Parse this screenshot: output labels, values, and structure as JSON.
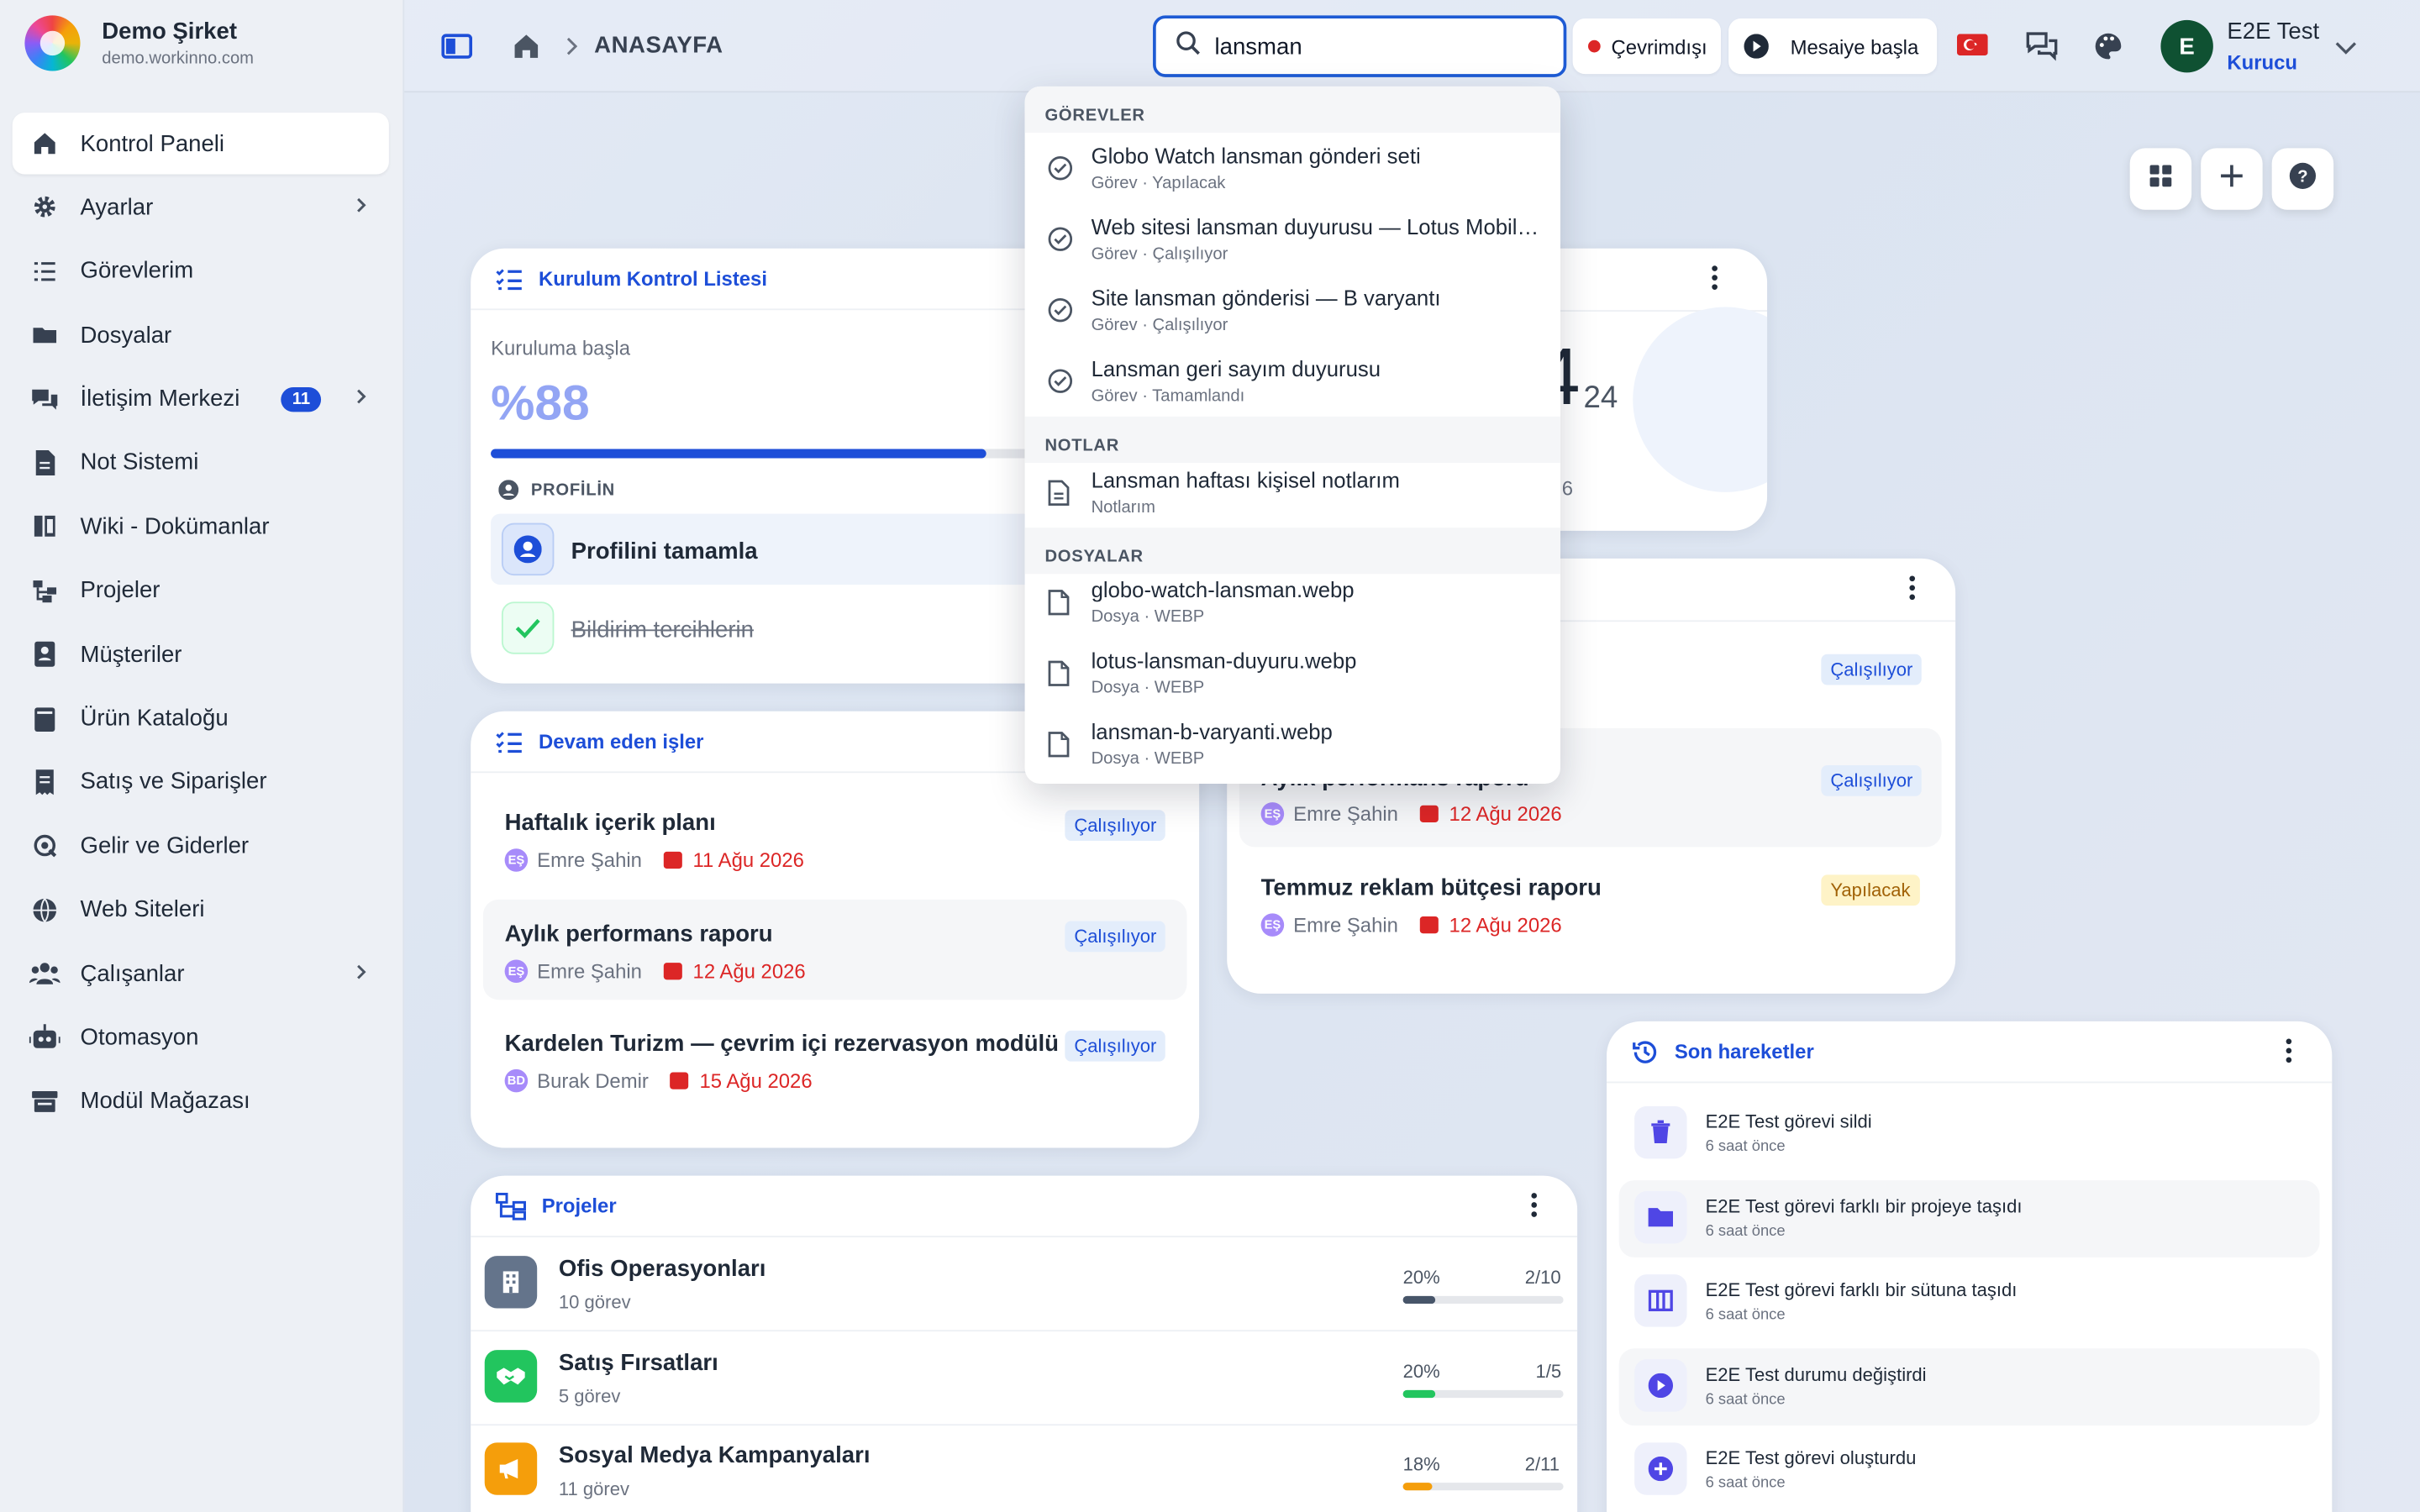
{
  "brand": {
    "name": "Demo Şirket",
    "domain": "demo.workinno.com"
  },
  "sidebar": {
    "items": [
      {
        "label": "Kontrol Paneli",
        "icon": "home-icon"
      },
      {
        "label": "Ayarlar",
        "icon": "gear-icon"
      },
      {
        "label": "Görevlerim",
        "icon": "tasks-icon"
      },
      {
        "label": "Dosyalar",
        "icon": "folder-icon"
      },
      {
        "label": "İletişim Merkezi",
        "icon": "chat-icon",
        "badge": "11"
      },
      {
        "label": "Not Sistemi",
        "icon": "note-icon"
      },
      {
        "label": "Wiki - Dokümanlar",
        "icon": "book-icon"
      },
      {
        "label": "Projeler",
        "icon": "project-icon"
      },
      {
        "label": "Müşteriler",
        "icon": "contact-icon"
      },
      {
        "label": "Ürün Kataloğu",
        "icon": "catalog-icon"
      },
      {
        "label": "Satış ve Siparişler",
        "icon": "receipt-icon"
      },
      {
        "label": "Gelir ve Giderler",
        "icon": "money-icon"
      },
      {
        "label": "Web Siteleri",
        "icon": "globe-icon"
      },
      {
        "label": "Çalışanlar",
        "icon": "people-icon"
      },
      {
        "label": "Otomasyon",
        "icon": "robot-icon"
      },
      {
        "label": "Modül Mağazası",
        "icon": "store-icon"
      }
    ]
  },
  "header": {
    "breadcrumb": "ANASAYFA",
    "search_value": "lansman",
    "status": "Çevrimdışı",
    "shift": "Mesaiye başla",
    "user_name": "E2E Test",
    "user_role": "Kurucu",
    "avatar": "E"
  },
  "search_results": {
    "sections": {
      "tasks": "GÖREVLER",
      "notes": "NOTLAR",
      "files": "DOSYALAR"
    },
    "tasks": [
      {
        "title": "Globo Watch lansman gönderi seti",
        "sub": "Görev · Yapılacak"
      },
      {
        "title": "Web sitesi lansman duyurusu — Lotus Mobilya",
        "sub": "Görev · Çalışılıyor"
      },
      {
        "title": "Site lansman gönderisi — B varyantı",
        "sub": "Görev · Çalışılıyor"
      },
      {
        "title": "Lansman geri sayım duyurusu",
        "sub": "Görev · Tamamlandı"
      }
    ],
    "notes": [
      {
        "title": "Lansman haftası kişisel notlarım",
        "sub": "Notlarım"
      }
    ],
    "files": [
      {
        "title": "globo-watch-lansman.webp",
        "sub": "Dosya · WEBP"
      },
      {
        "title": "lotus-lansman-duyuru.webp",
        "sub": "Dosya · WEBP"
      },
      {
        "title": "lansman-b-varyanti.webp",
        "sub": "Dosya · WEBP"
      }
    ]
  },
  "setup": {
    "title": "Kurulum Kontrol Listesi",
    "start_label": "Kuruluma başla",
    "percent_text": "%88",
    "progress": 0.88,
    "section": "PROFİLİN",
    "items": [
      {
        "label": "Profilini tamamla"
      },
      {
        "label": "Bildirim tercihlerin"
      }
    ]
  },
  "stats_card": {
    "big": "4",
    "small": "24",
    "sub": "6"
  },
  "ongoing": {
    "title": "Devam eden işler",
    "rows": [
      {
        "title": "Haftalık içerik planı",
        "user": "Emre Şahin",
        "initials": "EŞ",
        "due": "11 Ağu 2026",
        "status": "Çalışılıyor"
      },
      {
        "title": "Aylık performans raporu",
        "user": "Emre Şahin",
        "initials": "EŞ",
        "due": "12 Ağu 2026",
        "status": "Çalışılıyor"
      },
      {
        "title": "Kardelen Turizm — çevrim içi rezervasyon modülü",
        "user": "Burak Demir",
        "initials": "BD",
        "due": "15 Ağu 2026",
        "status": "Çalışılıyor"
      }
    ]
  },
  "right_tasks": {
    "rows": [
      {
        "status": "Çalışılıyor"
      },
      {
        "title": "Aylık performans raporu",
        "user": "Emre Şahin",
        "initials": "EŞ",
        "due": "12 Ağu 2026",
        "status": "Çalışılıyor"
      },
      {
        "title": "Temmuz reklam bütçesi raporu",
        "user": "Emre Şahin",
        "initials": "EŞ",
        "due": "12 Ağu 2026",
        "status": "Yapılacak"
      }
    ]
  },
  "activity": {
    "title": "Son hareketler",
    "items": [
      {
        "text": "E2E Test görevi sildi",
        "time": "6 saat önce",
        "icon": "trash-icon"
      },
      {
        "text": "E2E Test görevi farklı bir projeye taşıdı",
        "time": "6 saat önce",
        "icon": "folder-open-icon"
      },
      {
        "text": "E2E Test görevi farklı bir sütuna taşıdı",
        "time": "6 saat önce",
        "icon": "columns-icon"
      },
      {
        "text": "E2E Test durumu değiştirdi",
        "time": "6 saat önce",
        "icon": "play-icon"
      },
      {
        "text": "E2E Test görevi oluşturdu",
        "time": "6 saat önce",
        "icon": "plus-circle-icon"
      }
    ]
  },
  "projects": {
    "title": "Projeler",
    "items": [
      {
        "name": "Ofis Operasyonları",
        "sub": "10 görev",
        "pct": "20%",
        "progress": 0.2,
        "count": "2/10",
        "color": "#64748b",
        "bar_color": "#475569"
      },
      {
        "name": "Satış Fırsatları",
        "sub": "5 görev",
        "pct": "20%",
        "progress": 0.2,
        "count": "1/5",
        "color": "#22c55e",
        "bar_color": "#22c55e"
      },
      {
        "name": "Sosyal Medya Kampanyaları",
        "sub": "11 görev",
        "pct": "18%",
        "progress": 0.18,
        "count": "2/11",
        "color": "#f59e0b",
        "bar_color": "#f59e0b"
      }
    ]
  }
}
